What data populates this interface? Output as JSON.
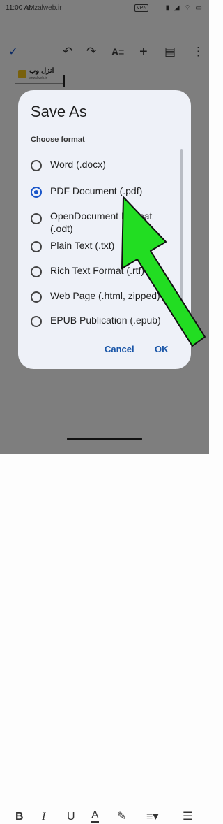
{
  "status_bar": {
    "time": "11:00 AM",
    "watermark": "anzalweb.ir",
    "vpn_badge": "VPN",
    "icons_text": "▮ ◢ ⌔ ▭"
  },
  "toolbar": {
    "icons": [
      "check-icon",
      "undo-icon",
      "redo-icon",
      "text-format-icon",
      "add-icon",
      "comment-icon",
      "more-vert-icon"
    ]
  },
  "document": {
    "logo_text": "انزل وب",
    "logo_subtext": "anzalweb.ir"
  },
  "dialog": {
    "title": "Save As",
    "subtitle": "Choose format",
    "options": [
      {
        "label": "Word (.docx)",
        "selected": false
      },
      {
        "label": "PDF Document (.pdf)",
        "selected": true
      },
      {
        "label": "OpenDocument Format (.odt)",
        "selected": false
      },
      {
        "label": "Plain Text (.txt)",
        "selected": false
      },
      {
        "label": "Rich Text Format (.rtf)",
        "selected": false
      },
      {
        "label": "Web Page (.html, zipped)",
        "selected": false
      },
      {
        "label": "EPUB Publication (.epub)",
        "selected": false
      }
    ],
    "cancel_label": "Cancel",
    "ok_label": "OK"
  },
  "bottom_toolbar": {
    "bold": "B",
    "italic": "I",
    "underline": "U",
    "text_color": "A"
  },
  "colors": {
    "accent": "#1a56c9",
    "arrow_fill": "#22dd22",
    "dialog_bg": "#eef1f8"
  }
}
